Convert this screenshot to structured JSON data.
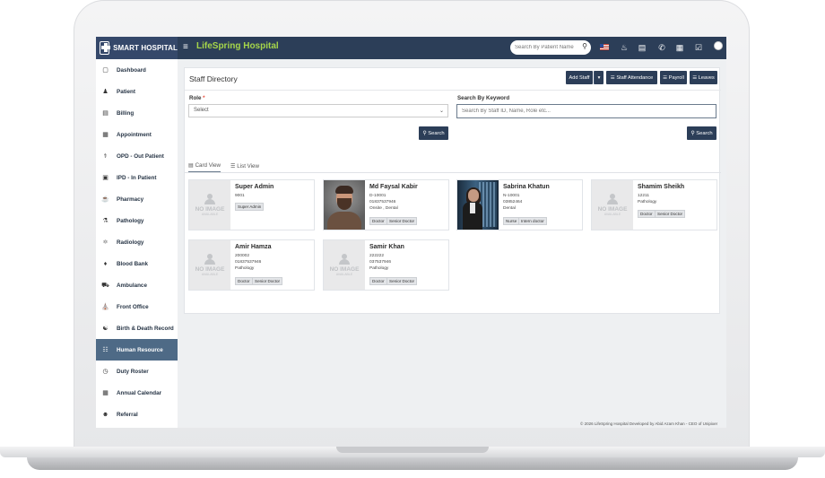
{
  "topbar": {
    "brand": "SMART HOSPITAL",
    "hospital_name": "LifeSpring Hospital",
    "search_placeholder": "Search By Patient Name"
  },
  "sidebar": {
    "items": [
      {
        "label": "Dashboard",
        "icon": "monitor-icon"
      },
      {
        "label": "Patient",
        "icon": "user-icon"
      },
      {
        "label": "Billing",
        "icon": "file-icon"
      },
      {
        "label": "Appointment",
        "icon": "calendar-icon"
      },
      {
        "label": "OPD - Out Patient",
        "icon": "stethoscope-icon"
      },
      {
        "label": "IPD - In Patient",
        "icon": "bed-icon"
      },
      {
        "label": "Pharmacy",
        "icon": "mortar-pestle-icon"
      },
      {
        "label": "Pathology",
        "icon": "flask-icon"
      },
      {
        "label": "Radiology",
        "icon": "microscope-icon"
      },
      {
        "label": "Blood Bank",
        "icon": "tint-icon"
      },
      {
        "label": "Ambulance",
        "icon": "ambulance-icon"
      },
      {
        "label": "Front Office",
        "icon": "building-icon"
      },
      {
        "label": "Birth & Death Record",
        "icon": "bank-icon"
      },
      {
        "label": "Human Resource",
        "icon": "sitemap-icon"
      },
      {
        "label": "Duty Roster",
        "icon": "clock-icon"
      },
      {
        "label": "Annual Calendar",
        "icon": "calendar-check-icon"
      },
      {
        "label": "Referral",
        "icon": "users-icon"
      }
    ],
    "active": "Human Resource"
  },
  "page": {
    "title": "Staff Directory",
    "buttons": {
      "add_staff": "Add Staff",
      "staff_attendance": "Staff Attendance",
      "payroll": "Payroll",
      "leaves": "Leaves"
    },
    "role_label": "Role",
    "role_required": "*",
    "role_value": "Select",
    "keyword_label": "Search By Keyword",
    "keyword_placeholder": "Search By Staff ID, Name, Role etc...",
    "search_label": "Search",
    "tabs": [
      "Card View",
      "List View"
    ],
    "active_tab": "Card View"
  },
  "no_image": {
    "line1": "NO IMAGE",
    "line2": "AVAILABLE"
  },
  "staff": [
    {
      "name": "Super Admin",
      "lines": [
        "9001"
      ],
      "tags": [
        "Super Admin"
      ],
      "photo": "none"
    },
    {
      "name": "Md Faysal Kabir",
      "lines": [
        "D-10001",
        "01837537946",
        "Onsite , Dental"
      ],
      "tags": [
        "Doctor",
        "Senior Doctor"
      ],
      "photo": "man"
    },
    {
      "name": "Sabrina Khatun",
      "lines": [
        "N-10001",
        "03852464",
        "Dental"
      ],
      "tags": [
        "Nurse",
        "Intern doctor"
      ],
      "photo": "woman"
    },
    {
      "name": "Shamim Sheikh",
      "lines": [
        "12211",
        "Pathology"
      ],
      "tags": [
        "Doctor",
        "Senior Doctor"
      ],
      "photo": "none"
    },
    {
      "name": "Amir Hamza",
      "lines": [
        "200002",
        "01837537946",
        "Pathology"
      ],
      "tags": [
        "Doctor",
        "Senior Doctor"
      ],
      "photo": "none"
    },
    {
      "name": "Samir Khan",
      "lines": [
        "222222",
        "037537946",
        "Pathology"
      ],
      "tags": [
        "Doctor",
        "Senior Doctor"
      ],
      "photo": "none"
    }
  ],
  "footer": "© 2026 LifeSpring Hospital Developed by Abid Azam Khan - CEO of Unipixer",
  "colors": {
    "navbar": "#2c3e58",
    "accent_green": "#a6d64a",
    "sidebar_active": "#4e6a86"
  }
}
